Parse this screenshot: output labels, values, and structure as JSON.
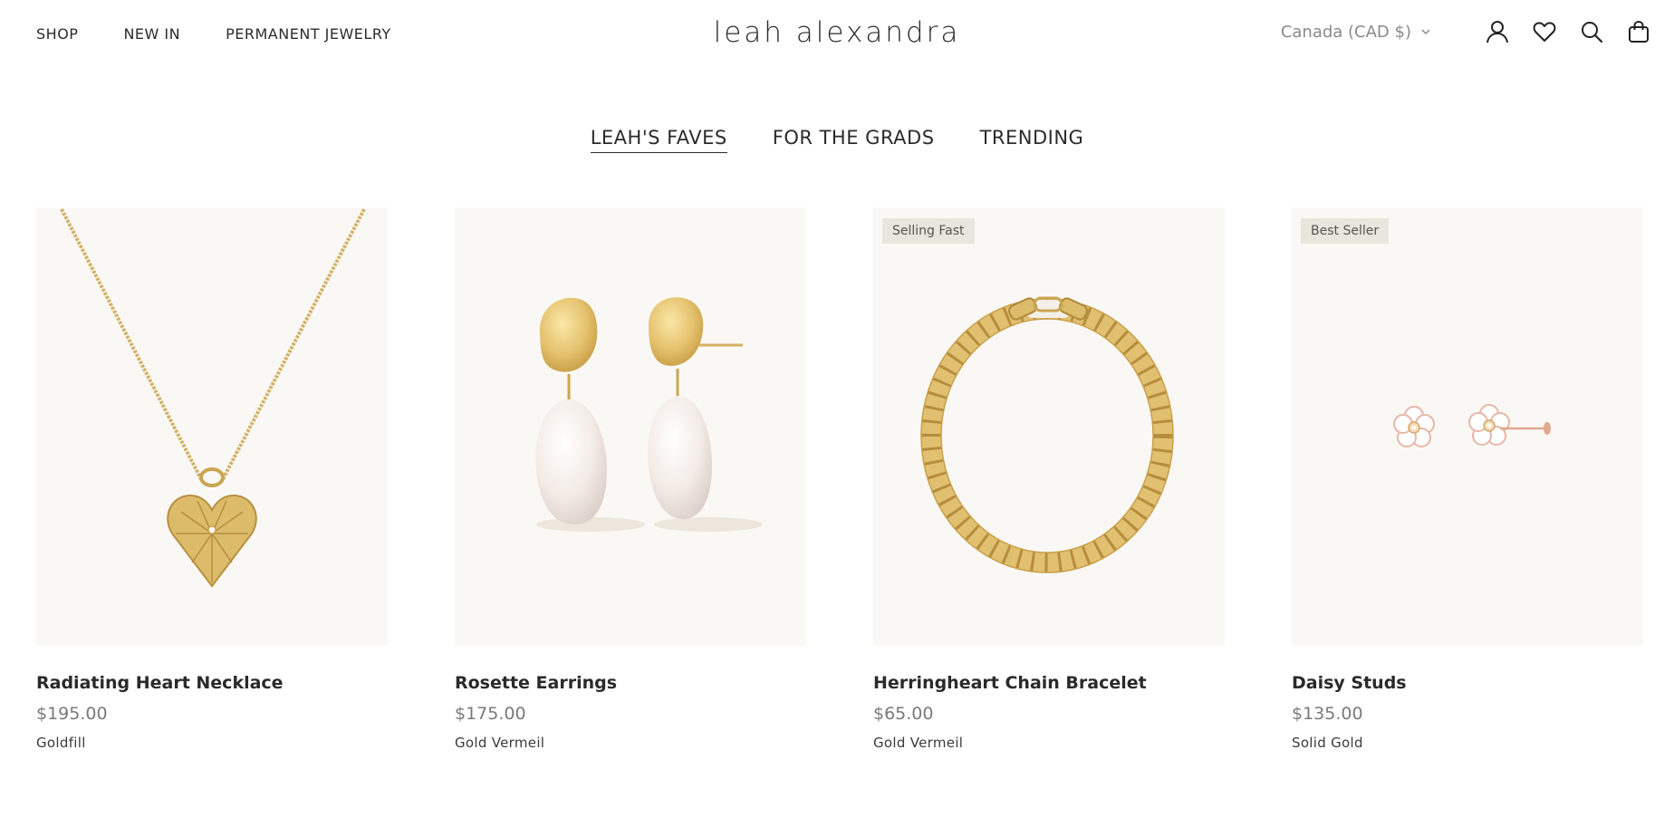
{
  "header": {
    "nav": [
      "SHOP",
      "NEW IN",
      "PERMANENT JEWELRY"
    ],
    "logo": "leah alexandra",
    "currency": "Canada (CAD $)",
    "icons": [
      "account-icon",
      "wishlist-heart-icon",
      "search-icon",
      "cart-bag-icon"
    ]
  },
  "tabs": [
    {
      "label": "LEAH'S FAVES",
      "active": true
    },
    {
      "label": "FOR THE GRADS",
      "active": false
    },
    {
      "label": "TRENDING",
      "active": false
    }
  ],
  "products": [
    {
      "name": "Radiating Heart Necklace",
      "price": "$195.00",
      "material": "Goldfill",
      "badge": ""
    },
    {
      "name": "Rosette Earrings",
      "price": "$175.00",
      "material": "Gold Vermeil",
      "badge": ""
    },
    {
      "name": "Herringheart Chain Bracelet",
      "price": "$65.00",
      "material": "Gold Vermeil",
      "badge": "Selling Fast"
    },
    {
      "name": "Daisy Studs",
      "price": "$135.00",
      "material": "Solid Gold",
      "badge": "Best Seller"
    }
  ],
  "colors": {
    "image_bg": "#faf8f4",
    "gold": "#d9b866",
    "badge_bg": "#e8e6dd"
  }
}
